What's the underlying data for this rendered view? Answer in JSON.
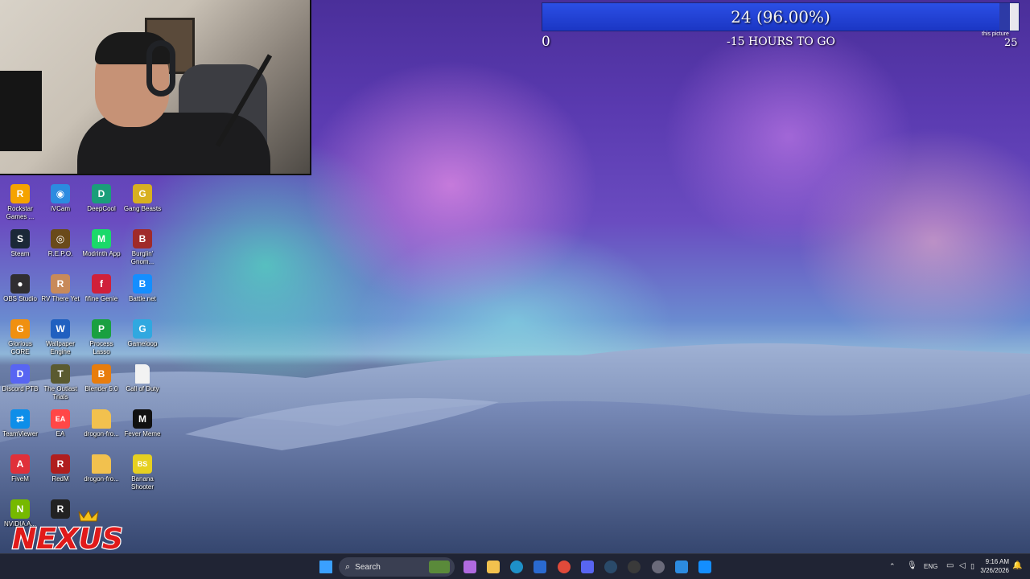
{
  "goal_overlay": {
    "bar_text": "24 (96.00%)",
    "progress_fraction": 0.96,
    "start_value": "0",
    "countdown": "-15 HOURS TO GO",
    "corner_caption": "this picture",
    "end_value": "25"
  },
  "desktop_icons": [
    {
      "label": "Rockstar Games ...",
      "icon": "rockstar-icon",
      "color": "#f5a300",
      "glyph": "R"
    },
    {
      "label": "iVCam",
      "icon": "ivcam-icon",
      "color": "#2c8be0",
      "glyph": "◉"
    },
    {
      "label": "DeepCool",
      "icon": "deepcool-icon",
      "color": "#1a9e7a",
      "glyph": "D"
    },
    {
      "label": "Gang Beasts",
      "icon": "gang-beasts-icon",
      "color": "#d8b020",
      "glyph": "G"
    },
    {
      "label": "Steam",
      "icon": "steam-icon",
      "color": "#1b2838",
      "glyph": "S"
    },
    {
      "label": "R.E.P.O.",
      "icon": "repo-icon",
      "color": "#6a4a1a",
      "glyph": "◎"
    },
    {
      "label": "Modrinth App",
      "icon": "modrinth-icon",
      "color": "#1bd96a",
      "glyph": "M"
    },
    {
      "label": "Burglin' Gnom...",
      "icon": "burglin-gnomes-icon",
      "color": "#a02a2a",
      "glyph": "B"
    },
    {
      "label": "OBS Studio",
      "icon": "obs-icon",
      "color": "#302e31",
      "glyph": "●"
    },
    {
      "label": "RV There Yet",
      "icon": "rv-there-yet-icon",
      "color": "#c88a5a",
      "glyph": "R"
    },
    {
      "label": "fifine Genie",
      "icon": "fifine-genie-icon",
      "color": "#d0203a",
      "glyph": "f"
    },
    {
      "label": "Battle.net",
      "icon": "battlenet-icon",
      "color": "#148eff",
      "glyph": "B"
    },
    {
      "label": "Glorious CORE",
      "icon": "glorious-core-icon",
      "color": "#f09010",
      "glyph": "G"
    },
    {
      "label": "Wallpaper Engine",
      "icon": "wallpaper-engine-icon",
      "color": "#2060c0",
      "glyph": "W"
    },
    {
      "label": "Process Lasso",
      "icon": "process-lasso-icon",
      "color": "#1aa040",
      "glyph": "P"
    },
    {
      "label": "Gameloop",
      "icon": "gameloop-icon",
      "color": "#30a8e0",
      "glyph": "G"
    },
    {
      "label": "Discord PTB",
      "icon": "discord-ptb-icon",
      "color": "#5865f2",
      "glyph": "D"
    },
    {
      "label": "The Outlast Trials",
      "icon": "outlast-trials-icon",
      "color": "#5a5a30",
      "glyph": "T"
    },
    {
      "label": "Blender 5.0",
      "icon": "blender-icon",
      "color": "#e87d0d",
      "glyph": "B"
    },
    {
      "label": "Call of Duty",
      "icon": "file-icon",
      "color": "#f2f2f2",
      "glyph": ""
    },
    {
      "label": "TeamViewer",
      "icon": "teamviewer-icon",
      "color": "#0e8ee9",
      "glyph": "⇄"
    },
    {
      "label": "EA",
      "icon": "ea-icon",
      "color": "#ff4747",
      "glyph": "EA"
    },
    {
      "label": "drogon-fro...",
      "icon": "folder-icon",
      "color": "#f2c14e",
      "glyph": ""
    },
    {
      "label": "Fever Meme",
      "icon": "fever-meme-icon",
      "color": "#111111",
      "glyph": "M"
    },
    {
      "label": "FiveM",
      "icon": "fivem-icon",
      "color": "#e0303a",
      "glyph": "A"
    },
    {
      "label": "RedM",
      "icon": "redm-icon",
      "color": "#b01e1e",
      "glyph": "R"
    },
    {
      "label": "drogon-fro...",
      "icon": "folder-icon",
      "color": "#f2c14e",
      "glyph": ""
    },
    {
      "label": "Banana Shooter",
      "icon": "banana-shooter-icon",
      "color": "#e6d020",
      "glyph": "BS"
    },
    {
      "label": "NVIDIA A...",
      "icon": "nvidia-icon",
      "color": "#76b900",
      "glyph": "N"
    },
    {
      "label": "",
      "icon": "roblox-icon",
      "color": "#222222",
      "glyph": "R"
    }
  ],
  "taskbar": {
    "search_label": "Search",
    "apps": [
      {
        "icon": "start-icon"
      },
      {
        "icon": "widgets-icon"
      },
      {
        "icon": "copilot-icon"
      },
      {
        "icon": "file-explorer-icon"
      },
      {
        "icon": "edge-icon"
      },
      {
        "icon": "store-icon"
      },
      {
        "icon": "chrome-icon"
      },
      {
        "icon": "discord-icon"
      },
      {
        "icon": "steam-icon"
      },
      {
        "icon": "obs-icon"
      },
      {
        "icon": "settings-icon"
      },
      {
        "icon": "ivcam-icon"
      },
      {
        "icon": "battlenet-icon"
      }
    ],
    "language": "ENG",
    "time": "9:16 AM",
    "date": "3/26/2026"
  }
}
